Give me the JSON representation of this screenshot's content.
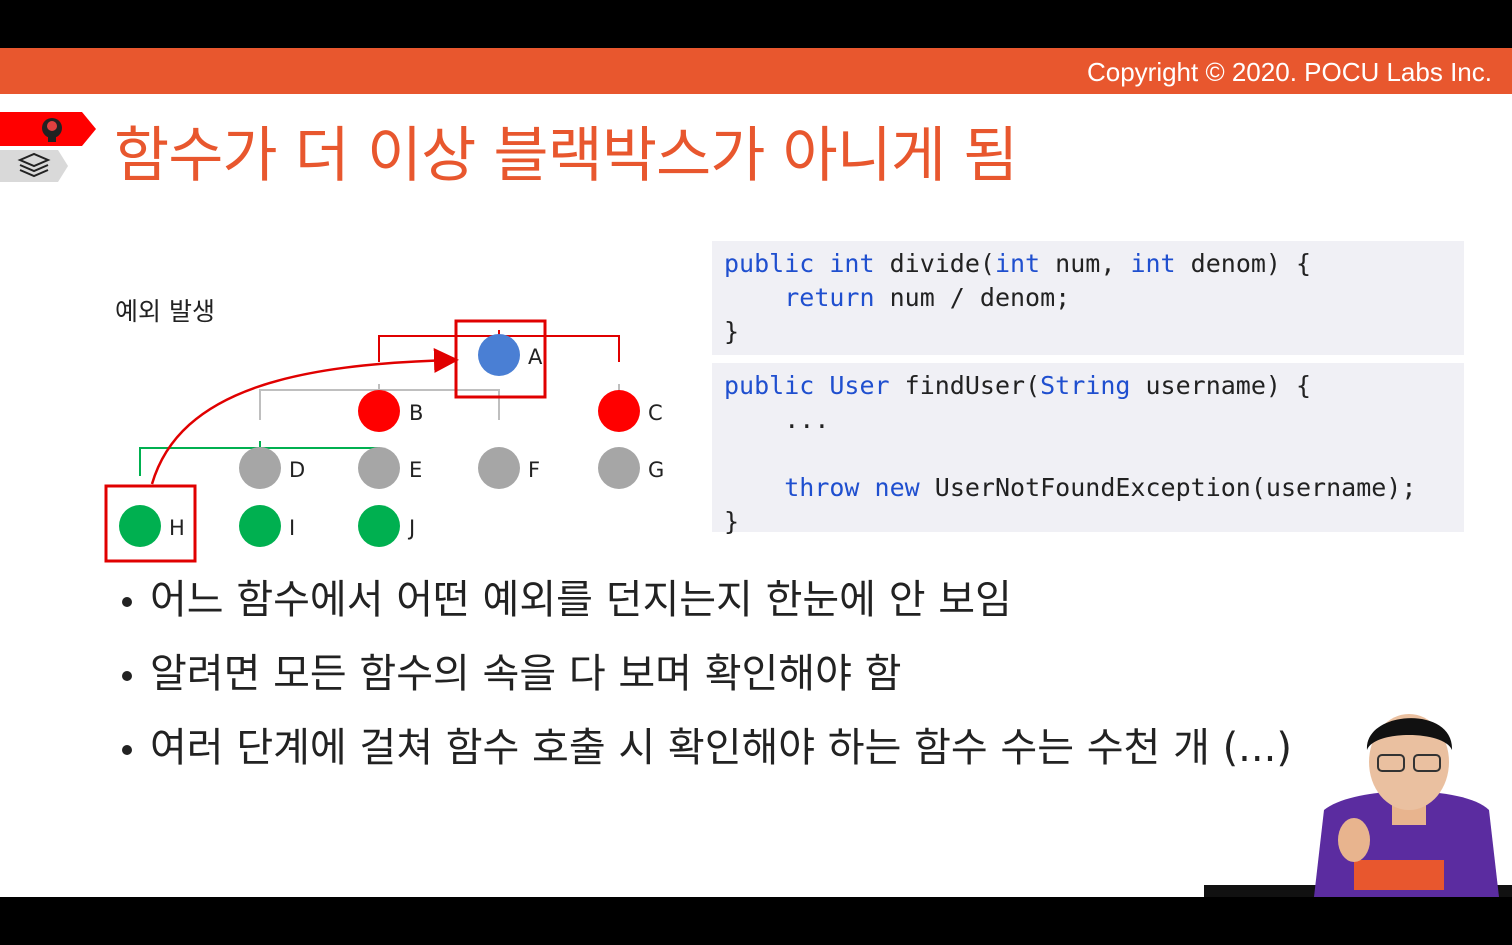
{
  "header": {
    "copyright": "Copyright © 2020. POCU Labs Inc."
  },
  "title": "함수가 더 이상 블랙박스가 아니게 됨",
  "diagram": {
    "exception_label": "예외 발생",
    "nodes": [
      {
        "label": "A",
        "color": "#4a7fd4"
      },
      {
        "label": "B",
        "color": "#ff0000"
      },
      {
        "label": "C",
        "color": "#ff0000"
      },
      {
        "label": "D",
        "color": "#a6a6a6"
      },
      {
        "label": "E",
        "color": "#a6a6a6"
      },
      {
        "label": "F",
        "color": "#a6a6a6"
      },
      {
        "label": "G",
        "color": "#a6a6a6"
      },
      {
        "label": "H",
        "color": "#00b050"
      },
      {
        "label": "I",
        "color": "#00b050"
      },
      {
        "label": "J",
        "color": "#00b050"
      }
    ]
  },
  "code": {
    "block1": {
      "l1": {
        "a": "public",
        "b": "int",
        "c": "divide(",
        "d": "int",
        "e": "num,",
        "f": "int",
        "g": "denom) {"
      },
      "l2": {
        "a": "return",
        "b": "num / denom;"
      },
      "l3": "}"
    },
    "block2": {
      "l1": {
        "a": "public",
        "b": "User",
        "c": "findUser(",
        "d": "String",
        "e": "username) {"
      },
      "l2": "...",
      "l4": {
        "a": "throw",
        "b": "new",
        "c": "UserNotFoundException(username);"
      },
      "l5": "}"
    }
  },
  "bullets": [
    "어느 함수에서 어떤 예외를 던지는지 한눈에 안 보임",
    "알려면 모든 함수의 속을 다 보며 확인해야 함",
    "여러 단계에 걸쳐 함수 호출 시 확인해야 하는 함수 수는 수천 개 (...)"
  ],
  "colors": {
    "accent": "#e8572e",
    "keyword": "#1f4fcf",
    "highlight_box": "#e00000"
  },
  "icons": [
    "brain-icon",
    "stack-icon"
  ]
}
